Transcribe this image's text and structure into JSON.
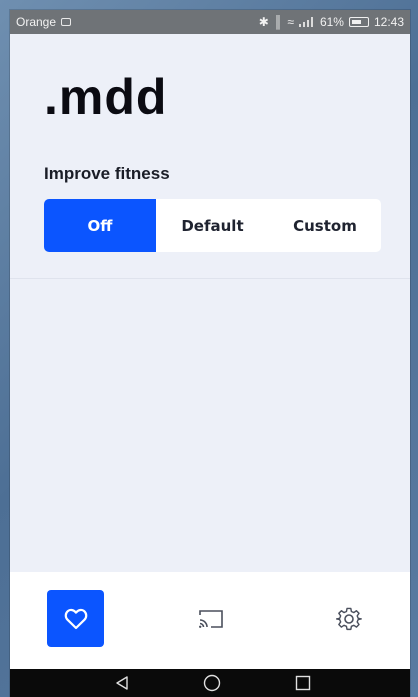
{
  "status_bar": {
    "carrier": "Orange",
    "battery": "61%",
    "time": "12:43"
  },
  "app": {
    "logo": ".mdd",
    "section_title": "Improve fitness",
    "segments": [
      {
        "label": "Off",
        "selected": true
      },
      {
        "label": "Default",
        "selected": false
      },
      {
        "label": "Custom",
        "selected": false
      }
    ]
  },
  "bottom_nav": {
    "items": [
      {
        "icon": "heart-icon",
        "active": true
      },
      {
        "icon": "cast-icon",
        "active": false
      },
      {
        "icon": "gear-icon",
        "active": false
      }
    ]
  },
  "system_nav": {
    "items": [
      "back-icon",
      "home-icon",
      "recents-icon"
    ]
  },
  "colors": {
    "accent": "#0b55ff",
    "background": "#edf0f8",
    "status_bar": "#6f7377"
  }
}
